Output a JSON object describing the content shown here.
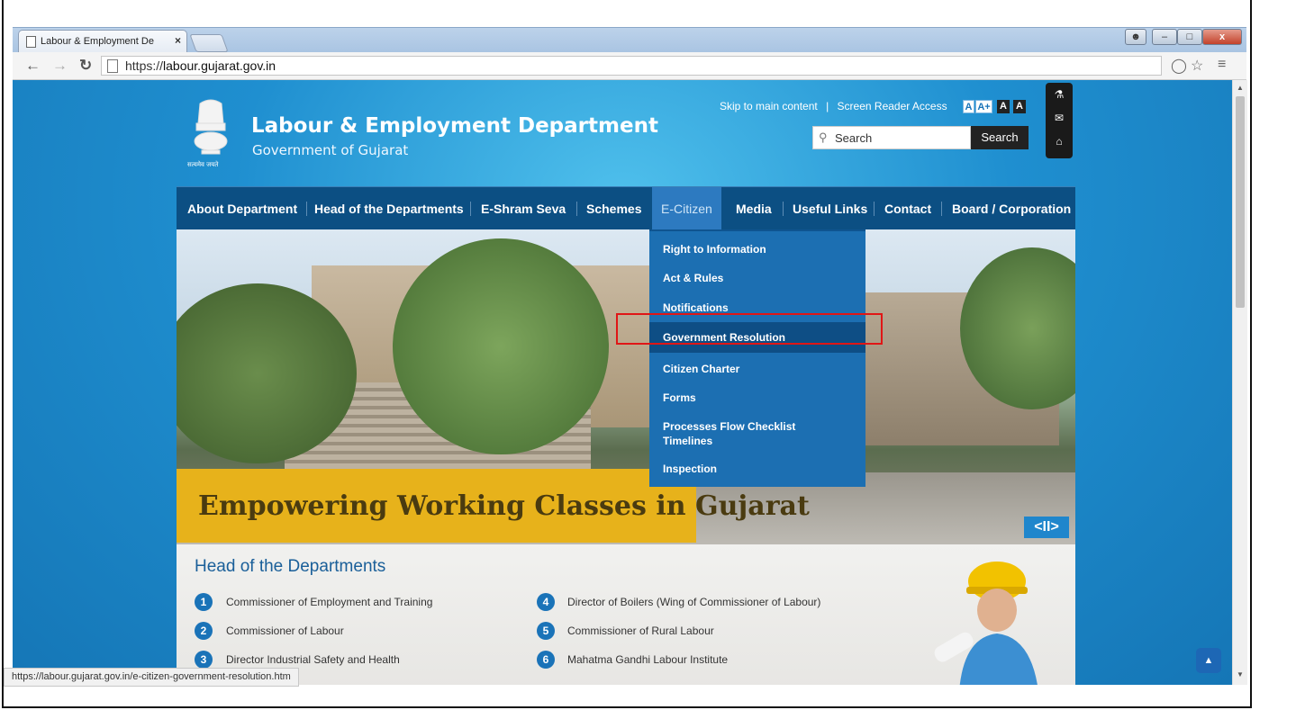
{
  "browser": {
    "tab_title": "Labour & Employment De",
    "tab_close": "×",
    "url_prefix": "https://",
    "url_host": "labour.gujarat.gov.in",
    "status_url": "https://labour.gujarat.gov.in/e-citizen-government-resolution.htm"
  },
  "header": {
    "dept_name": "Labour & Employment Department",
    "govt_name": "Government of Gujarat",
    "skip_link": "Skip to main content",
    "separator": "|",
    "reader_link": "Screen Reader Access",
    "font_sizes": [
      "A",
      "A+",
      "A",
      "A"
    ],
    "search_placeholder": "Search",
    "search_button": "Search"
  },
  "nav": {
    "items": [
      "About Department",
      "Head of the Departments",
      "E-Shram Seva",
      "Schemes",
      "E-Citizen",
      "Media",
      "Useful Links",
      "Contact",
      "Board / Corporation"
    ],
    "active": "E-Citizen"
  },
  "dropdown": {
    "items": [
      "Right to Information",
      "Act & Rules",
      "Notifications",
      "Government Resolution",
      "Citizen Charter",
      "Forms",
      "Processes Flow Checklist",
      "Timelines",
      "Inspection"
    ],
    "selected": "Government Resolution"
  },
  "banner": {
    "tagline": "Empowering Working Classes in Gujarat",
    "control": "<II>"
  },
  "departments": {
    "title": "Head of the Departments",
    "items": [
      {
        "num": "1",
        "name": "Commissioner of Employment and Training"
      },
      {
        "num": "2",
        "name": "Commissioner of Labour"
      },
      {
        "num": "3",
        "name": "Director Industrial Safety and Health"
      },
      {
        "num": "4",
        "name": "Director of Boilers (Wing of Commissioner of Labour)"
      },
      {
        "num": "5",
        "name": "Commissioner of Rural Labour"
      },
      {
        "num": "6",
        "name": "Mahatma Gandhi Labour Institute"
      }
    ]
  },
  "icons": {
    "back": "back-arrow-icon",
    "forward": "forward-arrow-icon",
    "reload": "reload-icon",
    "page": "page-icon",
    "shield": "shield-icon",
    "star": "bookmark-star-icon",
    "menu": "menu-icon",
    "sitemap": "sitemap-icon",
    "mail": "mail-icon",
    "home": "home-icon",
    "search": "search-icon",
    "scroll_top": "scroll-to-top-icon"
  },
  "colors": {
    "nav_bg": "#0c4f83",
    "dropdown_bg": "#1c6fb2",
    "dropdown_selected": "#0e4e85",
    "tagline_bg": "#e7b21b",
    "highlight": "#e01616"
  }
}
